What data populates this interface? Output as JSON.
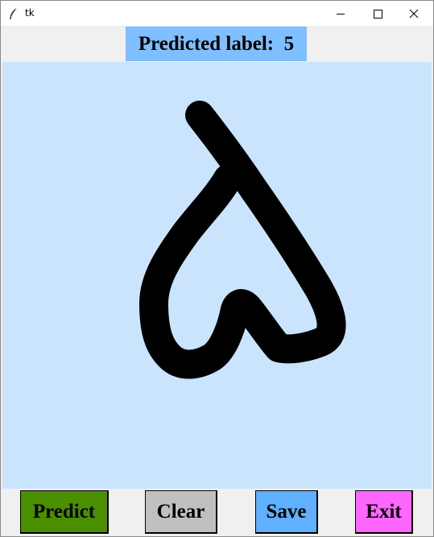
{
  "window": {
    "title": "tk",
    "controls": [
      "minimize-icon",
      "maximize-icon",
      "close-icon"
    ]
  },
  "prediction": {
    "text": "Predicted label:  5",
    "background_color": "#7fbfff"
  },
  "canvas": {
    "background_color": "#cae4fd",
    "stroke_color": "#000000",
    "content": "hand-drawn digit"
  },
  "buttons": {
    "predict": {
      "label": "Predict",
      "color": "#4a8f00"
    },
    "clear": {
      "label": "Clear",
      "color": "#c0c0c0"
    },
    "save": {
      "label": "Save",
      "color": "#5fb0ff"
    },
    "exit": {
      "label": "Exit",
      "color": "#ff66ff"
    }
  }
}
